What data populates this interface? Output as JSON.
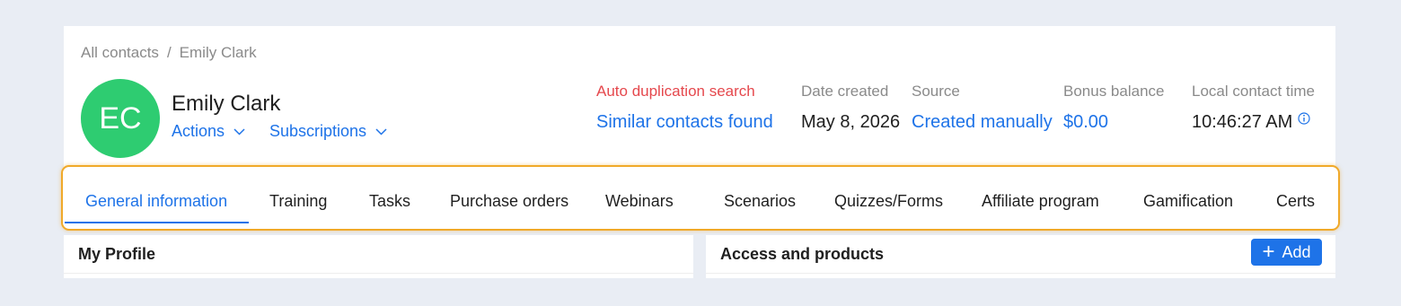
{
  "breadcrumb": {
    "parent": "All contacts",
    "separator": "/",
    "current": "Emily Clark"
  },
  "contact": {
    "initials": "EC",
    "name": "Emily Clark",
    "avatar_color": "#2ecc71",
    "actions_label": "Actions",
    "subscriptions_label": "Subscriptions"
  },
  "duplication": {
    "label": "Auto duplication search",
    "value": "Similar contacts found"
  },
  "date_created": {
    "label": "Date created",
    "value": "May 8, 2026"
  },
  "source": {
    "label": "Source",
    "value": "Created manually"
  },
  "bonus": {
    "label": "Bonus balance",
    "value": "$0.00"
  },
  "local_time": {
    "label": "Local contact time",
    "value": "10:46:27 AM"
  },
  "tabs": [
    {
      "label": "General information",
      "active": true
    },
    {
      "label": "Training"
    },
    {
      "label": "Tasks"
    },
    {
      "label": "Purchase orders"
    },
    {
      "label": "Webinars"
    },
    {
      "label": "Scenarios"
    },
    {
      "label": "Quizzes/Forms"
    },
    {
      "label": "Affiliate program"
    },
    {
      "label": "Gamification"
    },
    {
      "label": "Certs"
    }
  ],
  "panels": {
    "profile": {
      "title": "My Profile"
    },
    "access": {
      "title": "Access and products",
      "add_label": "Add"
    }
  },
  "colors": {
    "accent": "#1e73e8",
    "warning": "#e5484d",
    "highlight": "#f0a929",
    "background": "#e9edf4"
  }
}
